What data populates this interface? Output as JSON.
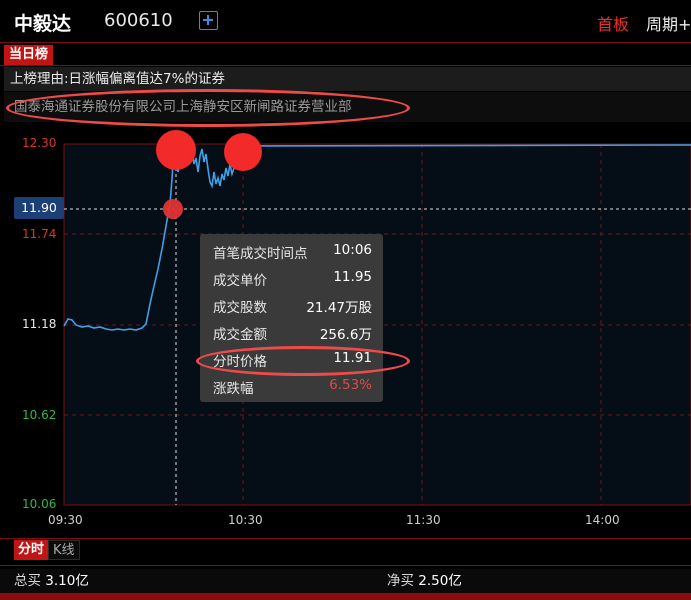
{
  "header": {
    "stock_name": "中毅达",
    "stock_code": "600610",
    "tab_first_board": "首板",
    "tab_period": "周期+"
  },
  "board": {
    "tag": "当日榜",
    "reason": "上榜理由:日涨幅偏离值达7%的证券",
    "branch": "国泰海通证券股份有限公司上海静安区新闸路证券营业部"
  },
  "chart": {
    "price_labels": [
      "12.30",
      "11.74",
      "11.18",
      "10.62",
      "10.06"
    ],
    "current_price": "11.90",
    "time_labels": [
      "09:30",
      "10:30",
      "11:30",
      "14:00"
    ]
  },
  "tooltip": {
    "rows": [
      {
        "label": "首笔成交时间点",
        "value": "10:06"
      },
      {
        "label": "成交单价",
        "value": "11.95"
      },
      {
        "label": "成交股数",
        "value": "21.47万股"
      },
      {
        "label": "成交金额",
        "value": "256.6万"
      },
      {
        "label": "分时价格",
        "value": "11.91"
      },
      {
        "label": "涨跌幅",
        "value": "6.53%"
      }
    ]
  },
  "mode_tabs": {
    "active": "分时",
    "inactive": "K线"
  },
  "summary": {
    "buy_total_label": "总买",
    "buy_total_value": "3.10亿",
    "net_buy_label": "净买",
    "net_buy_value": "2.50亿"
  },
  "colors": {
    "accent_red": "#c01515",
    "rise_red": "#e03030",
    "fall_green": "#2db84c",
    "line_blue": "#3fa0e8",
    "annotation": "#ee4a4a"
  }
}
